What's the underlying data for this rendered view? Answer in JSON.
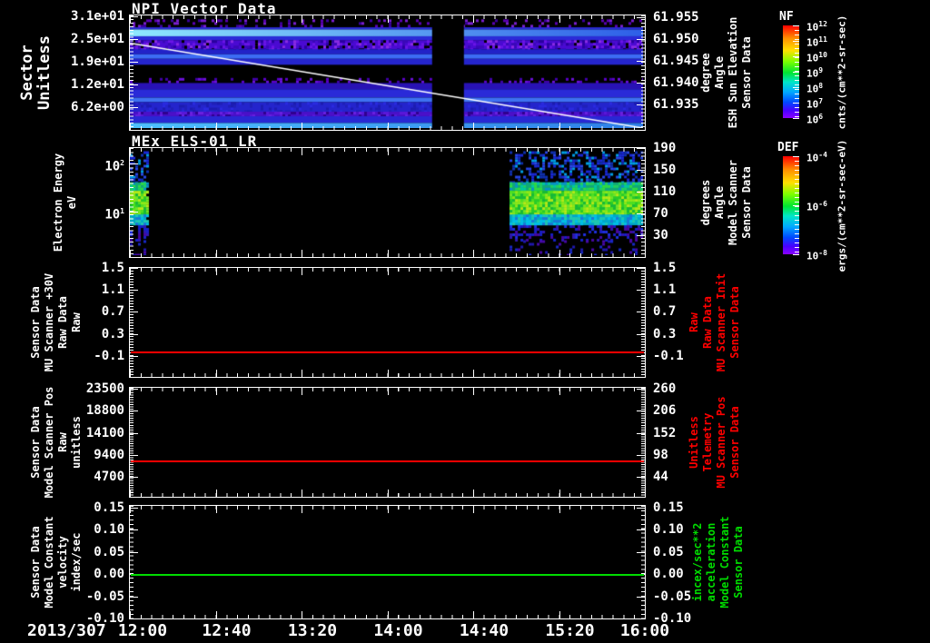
{
  "window": {
    "bg": "#000000",
    "text_color": "#ffffff"
  },
  "xaxis": {
    "date_label": "2013/307",
    "tick_labels": [
      "12:00",
      "12:40",
      "13:20",
      "14:00",
      "14:40",
      "15:20",
      "16:00"
    ]
  },
  "panels": [
    {
      "title": "NPI Vector Data",
      "left_label_lines": [
        "Sector",
        "Unitless"
      ],
      "left_tick_labels": [
        "3.1e+01",
        "2.5e+01",
        "1.9e+01",
        "1.2e+01",
        "6.2e+00"
      ],
      "right_tick_labels": [
        "61.955",
        "61.950",
        "61.945",
        "61.940",
        "61.935"
      ],
      "right_label_lines": [
        "Sensor Data",
        "ESH Sun Elevation",
        "Angle",
        "degree"
      ],
      "right_label_color": "#ffffff"
    },
    {
      "title": "MEx ELS-01 LR",
      "left_label_lines": [
        "Electron Energy",
        "eV"
      ],
      "left_tick_labels": [
        "10^2",
        "10^1"
      ],
      "right_tick_labels": [
        "190",
        "150",
        "110",
        "70",
        "30"
      ],
      "right_label_lines": [
        "Sensor Data",
        "Model Scanner",
        "Angle",
        "degrees"
      ],
      "right_label_color": "#ffffff"
    },
    {
      "title": "",
      "left_label_lines": [
        "Sensor Data",
        "MU Scanner +30V",
        "Raw Data",
        "Raw"
      ],
      "left_tick_labels": [
        "1.5",
        "1.1",
        "0.7",
        "0.3",
        "-0.1"
      ],
      "right_tick_labels": [
        "1.5",
        "1.1",
        "0.7",
        "0.3",
        "-0.1"
      ],
      "right_label_lines": [
        "Sensor Data",
        "MU Scanner Init",
        "Raw Data",
        "Raw"
      ],
      "right_label_color": "#ff0000"
    },
    {
      "title": "",
      "left_label_lines": [
        "Sensor Data",
        "Model Scanner Pos",
        "Raw",
        "unitless"
      ],
      "left_tick_labels": [
        "23500",
        "18800",
        "14100",
        "9400",
        "4700"
      ],
      "right_tick_labels": [
        "260",
        "206",
        "152",
        "98",
        "44"
      ],
      "right_label_lines": [
        "Sensor Data",
        "MU Scanner Pos",
        "Telemetry",
        "Unitless"
      ],
      "right_label_color": "#ff0000"
    },
    {
      "title": "",
      "left_label_lines": [
        "Sensor Data",
        "Model Constant",
        "velocity",
        "index/sec"
      ],
      "left_tick_labels": [
        "0.15",
        "0.10",
        "0.05",
        "0.00",
        "-0.05",
        "-0.10"
      ],
      "right_tick_labels": [
        "0.15",
        "0.10",
        "0.05",
        "0.00",
        "-0.05",
        "-0.10"
      ],
      "right_label_lines": [
        "Sensor Data",
        "Model Constant",
        "acceleration",
        "incex/sec**2"
      ],
      "right_label_color": "#00dd00"
    }
  ],
  "colorbars": [
    {
      "title": "NF",
      "tick_labels": [
        "10^12",
        "10^11",
        "10^10",
        "10^9",
        "10^8",
        "10^7",
        "10^6"
      ],
      "units": "cnts/(cm**2-sr-sec)"
    },
    {
      "title": "DEF",
      "tick_labels": [
        "10^-4",
        "10^-6",
        "10^-8"
      ],
      "units": "ergs/(cm**2-sr-sec-eV)"
    }
  ],
  "chart_data": [
    {
      "type": "heatmap",
      "title": "NPI Vector Data",
      "x_range": [
        "2013/307 12:00",
        "2013/307 16:00"
      ],
      "ylabel": "Sector Unitless",
      "y_ticks": [
        31,
        25,
        19,
        12,
        6.2
      ],
      "y_range": [
        0,
        31
      ],
      "z_units": "cnts/(cm**2-sr-sec)",
      "z_scale": "log",
      "z_range": [
        1000000.0,
        1000000000000.0
      ],
      "data_gap_interval": [
        "14:21",
        "14:36"
      ],
      "gap_fr": [
        0.589,
        0.651
      ],
      "overlay_line": {
        "name": "Sensor Data ESH Sun Elevation Angle (degrees)",
        "right_axis_ticks": [
          61.955,
          61.95,
          61.945,
          61.94,
          61.935
        ],
        "start_value": 61.949,
        "end_value": 61.9335,
        "color": "#ffffff"
      },
      "line_fr": [
        0.246,
        1.0
      ],
      "bands": [
        {
          "f0": 0.0,
          "f1": 0.035,
          "type": "solid",
          "color": "#000000"
        },
        {
          "f0": 0.035,
          "f1": 0.105,
          "type": "speckle",
          "bg": "#000000",
          "colors": [
            "#5a00b4",
            "#3c00a0",
            "#7a1fd0",
            "#000000"
          ],
          "density": 0.3
        },
        {
          "f0": 0.105,
          "f1": 0.125,
          "type": "solid",
          "color": "#2a2ad2"
        },
        {
          "f0": 0.125,
          "f1": 0.185,
          "type": "hgrad",
          "from": "#8fe9ff",
          "to": "#2e5fe8"
        },
        {
          "f0": 0.185,
          "f1": 0.22,
          "type": "solid",
          "color": "#2b2bd8"
        },
        {
          "f0": 0.22,
          "f1": 0.3,
          "type": "speckle",
          "bg": "#4a0ad2",
          "colors": [
            "#6a14e6",
            "#2a00a0",
            "#000000",
            "#8a2be2",
            "#3a08b8"
          ],
          "density": 0.55
        },
        {
          "f0": 0.3,
          "f1": 0.345,
          "type": "solid",
          "color": "#2222c8"
        },
        {
          "f0": 0.345,
          "f1": 0.385,
          "type": "solid",
          "color": "#3c6cf4"
        },
        {
          "f0": 0.385,
          "f1": 0.44,
          "type": "solid",
          "color": "#2525cd"
        },
        {
          "f0": 0.44,
          "f1": 0.555,
          "type": "solid",
          "color": "#000000"
        },
        {
          "f0": 0.555,
          "f1": 0.6,
          "type": "speckle",
          "bg": "#000000",
          "colors": [
            "#5a00c8",
            "#4000a8",
            "#6a10d8"
          ],
          "density": 0.22
        },
        {
          "f0": 0.6,
          "f1": 0.655,
          "type": "solid",
          "color": "#2812b4"
        },
        {
          "f0": 0.655,
          "f1": 0.73,
          "type": "solid",
          "color": "#2a2ad8"
        },
        {
          "f0": 0.73,
          "f1": 0.77,
          "type": "solid",
          "color": "#3e72f2"
        },
        {
          "f0": 0.77,
          "f1": 0.855,
          "type": "speckle",
          "bg": "#2424cc",
          "colors": [
            "#2020b8",
            "#2a2ae0",
            "#1c1cb0"
          ],
          "density": 0.35
        },
        {
          "f0": 0.855,
          "f1": 0.895,
          "type": "speckle",
          "bg": "#4a10c8",
          "colors": [
            "#6a20e0",
            "#30008f",
            "#5a18d8"
          ],
          "density": 0.45
        },
        {
          "f0": 0.895,
          "f1": 0.955,
          "type": "solid",
          "color": "#2828d4"
        },
        {
          "f0": 0.955,
          "f1": 1.0,
          "type": "hgrad",
          "from": "#4fc3ff",
          "to": "#2e7fe8"
        }
      ]
    },
    {
      "type": "heatmap",
      "title": "MEx ELS-01 LR",
      "ylabel": "Electron Energy (eV)",
      "y_scale": "log",
      "y_ticks": [
        100,
        10
      ],
      "z_units": "ergs/(cm**2-sr-sec-eV)",
      "z_scale": "log",
      "z_range": [
        1e-08,
        0.0001
      ],
      "right_axis": {
        "name": "Sensor Data Model Scanner Angle (degrees)",
        "ticks": [
          190,
          150,
          110,
          70,
          30
        ]
      },
      "data_intervals": [
        [
          "12:00",
          "12:07"
        ],
        [
          "14:58",
          "16:00"
        ]
      ],
      "peak_band_energy_eV": [
        8,
        40
      ],
      "segments": [
        {
          "x0": 0.0,
          "x1": 0.032
        },
        {
          "x0": 0.74,
          "x1": 1.0
        }
      ],
      "profile": [
        {
          "f0": 0.03,
          "f1": 0.32,
          "bg": "#000000",
          "colors": [
            "#1a28d8",
            "#2846e8",
            "#00a0e6",
            "#1030b0",
            "#000000"
          ],
          "density": 0.6
        },
        {
          "f0": 0.32,
          "f1": 0.4,
          "bg": "#10a878",
          "colors": [
            "#00c8a0",
            "#20d060",
            "#0890c8",
            "#30dc40"
          ],
          "density": 0.75
        },
        {
          "f0": 0.4,
          "f1": 0.62,
          "bg": "#28cc28",
          "colors": [
            "#50e020",
            "#90e818",
            "#18b838",
            "#70e428",
            "#b8e818"
          ],
          "density": 0.85
        },
        {
          "f0": 0.62,
          "f1": 0.72,
          "bg": "#00a8c8",
          "colors": [
            "#00c0e8",
            "#1878d8",
            "#20c8b0"
          ],
          "density": 0.7
        },
        {
          "f0": 0.72,
          "f1": 0.86,
          "bg": "#000000",
          "colors": [
            "#1820c8",
            "#3018b0",
            "#2030e0",
            "#4808a0"
          ],
          "density": 0.4
        },
        {
          "f0": 0.86,
          "f1": 1.0,
          "bg": "#000000",
          "colors": [
            "#2018b0",
            "#4808a8",
            "#1828c8"
          ],
          "density": 0.18
        }
      ]
    },
    {
      "type": "line",
      "ylabel": "Sensor Data MU Scanner +30V Raw Data Raw",
      "y_ticks": [
        1.5,
        1.1,
        0.7,
        0.3,
        -0.1
      ],
      "series": [
        {
          "name": "MU Scanner +30V Raw",
          "color": "#ff0000",
          "constant_value": 0.0
        }
      ],
      "line_fr": 0.775
    },
    {
      "type": "line",
      "ylabel": "Sensor Data Model Scanner Pos Raw unitless",
      "y_ticks": [
        23500,
        18800,
        14100,
        9400,
        4700
      ],
      "right_axis": {
        "name": "Sensor Data MU Scanner Pos Telemetry Unitless",
        "ticks": [
          260,
          206,
          152,
          98,
          44
        ]
      },
      "series": [
        {
          "name": "Model Scanner Pos Raw",
          "color": "#ff0000",
          "constant_value": 8200
        }
      ],
      "line_fr": 0.675
    },
    {
      "type": "line",
      "ylabel": "Sensor Data Model Constant velocity index/sec",
      "y_ticks": [
        0.15,
        0.1,
        0.05,
        0.0,
        -0.05,
        -0.1
      ],
      "series": [
        {
          "name": "Model Constant velocity",
          "color": "#00dd00",
          "constant_value": 0.0
        }
      ],
      "line_fr": 0.613
    }
  ]
}
